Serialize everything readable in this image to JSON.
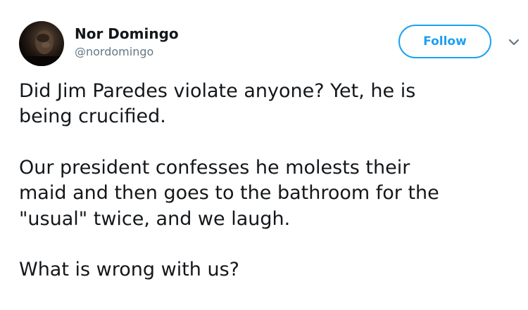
{
  "author": {
    "display_name": "Nor Domingo",
    "handle": "@nordomingo"
  },
  "actions": {
    "follow_label": "Follow"
  },
  "icons": {
    "caret": "chevron-down-icon"
  },
  "colors": {
    "accent": "#1da1f2",
    "text": "#14171a",
    "secondary": "#657786"
  },
  "tweet": {
    "paragraphs": [
      "Did Jim Paredes violate anyone? Yet, he is\nbeing crucified.",
      "Our president confesses he molests their\nmaid and then goes to the bathroom for the\n\"usual\" twice, and we laugh.",
      "What is wrong with us?"
    ]
  }
}
